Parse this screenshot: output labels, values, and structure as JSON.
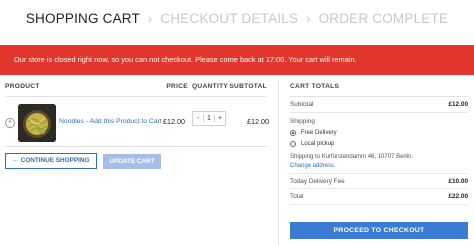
{
  "steps": {
    "cart": "SHOPPING CART",
    "checkout": "CHECKOUT DETAILS",
    "complete": "ORDER COMPLETE",
    "separator": "›"
  },
  "notice": "Our store is closed right now, so you can not checkout. Please come back at 17:00. Your cart will remain.",
  "cart_table": {
    "headers": {
      "product": "PRODUCT",
      "price": "PRICE",
      "quantity": "QUANTITY",
      "subtotal": "SUBTOTAL"
    },
    "items": [
      {
        "remove": "×",
        "name": "Noodles - Add this Product to Cart",
        "price": "£12.00",
        "qty_minus": "-",
        "qty": "1",
        "qty_plus": "+",
        "subtotal": "£12.00"
      }
    ]
  },
  "buttons": {
    "continue": "← CONTINUE SHOPPING",
    "update": "UPDATE CART",
    "checkout": "PROCEED TO CHECKOUT"
  },
  "totals": {
    "title": "CART TOTALS",
    "subtotal_label": "Subtotal",
    "subtotal_value": "£12.00",
    "shipping_label": "Shipping",
    "option_free": "Free Delivery",
    "option_pickup": "Local pickup",
    "shipping_to": "Shipping to Kurfürstendamm 46, 10707 Berlin.",
    "change_address": "Change address",
    "fee_label": "Today Delivery Fee",
    "fee_value": "£10.00",
    "total_label": "Total",
    "total_value": "£22.00"
  },
  "colors": {
    "accent": "#2f6fb5",
    "notice_bg": "#e1362c",
    "update_btn": "#a6bee5",
    "checkout_btn": "#3a7bd5"
  }
}
